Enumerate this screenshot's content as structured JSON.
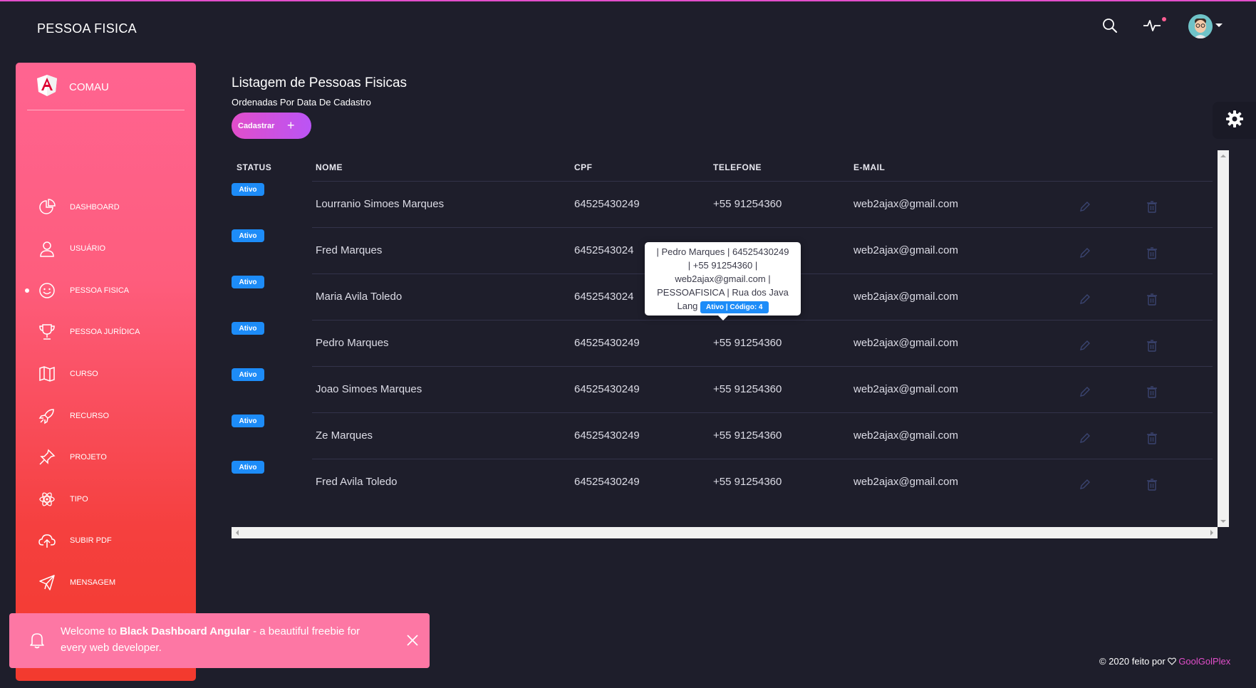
{
  "navbar": {
    "brand": "PESSOA FISICA"
  },
  "sidebar": {
    "title": "COMAU",
    "items": [
      {
        "label": "DASHBOARD",
        "icon": "chart-pie-icon",
        "active": false
      },
      {
        "label": "USUÁRIO",
        "icon": "user-icon",
        "active": false
      },
      {
        "label": "PESSOA FISICA",
        "icon": "smile-icon",
        "active": true
      },
      {
        "label": "PESSOA JURÍDICA",
        "icon": "trophy-icon",
        "active": false
      },
      {
        "label": "CURSO",
        "icon": "map-icon",
        "active": false
      },
      {
        "label": "RECURSO",
        "icon": "spaceship-icon",
        "active": false
      },
      {
        "label": "PROJETO",
        "icon": "pin-icon",
        "active": false
      },
      {
        "label": "TIPO",
        "icon": "atom-icon",
        "active": false
      },
      {
        "label": "SUBIR PDF",
        "icon": "cloud-upload-icon",
        "active": false
      },
      {
        "label": "MENSAGEM",
        "icon": "send-icon",
        "active": false
      }
    ]
  },
  "page": {
    "title": "Listagem de Pessoas Fisicas",
    "subtitle": "Ordenadas Por Data De Cadastro",
    "add_button": "Cadastrar",
    "add_icon": "+"
  },
  "table": {
    "headers": [
      "STATUS",
      "NOME",
      "CPF",
      "TELEFONE",
      "E-MAIL"
    ],
    "rows": [
      {
        "status": "Ativo",
        "nome": "Lourranio Simoes Marques",
        "cpf": "64525430249",
        "telefone": "+55 91254360",
        "email": "web2ajax@gmail.com"
      },
      {
        "status": "Ativo",
        "nome": "Fred Marques",
        "cpf": "6452543024",
        "telefone": "",
        "email": "web2ajax@gmail.com"
      },
      {
        "status": "Ativo",
        "nome": "Maria Avila Toledo",
        "cpf": "6452543024",
        "telefone": "",
        "email": "web2ajax@gmail.com"
      },
      {
        "status": "Ativo",
        "nome": "Pedro Marques",
        "cpf": "64525430249",
        "telefone": "+55 91254360",
        "email": "web2ajax@gmail.com"
      },
      {
        "status": "Ativo",
        "nome": "Joao Simoes Marques",
        "cpf": "64525430249",
        "telefone": "+55 91254360",
        "email": "web2ajax@gmail.com"
      },
      {
        "status": "Ativo",
        "nome": "Ze Marques",
        "cpf": "64525430249",
        "telefone": "+55 91254360",
        "email": "web2ajax@gmail.com"
      },
      {
        "status": "Ativo",
        "nome": "Fred Avila Toledo",
        "cpf": "64525430249",
        "telefone": "+55 91254360",
        "email": "web2ajax@gmail.com"
      }
    ]
  },
  "tooltip": {
    "line1": "| Pedro Marques | 64525430249",
    "line2": "| +55 91254360 |",
    "line3": "web2ajax@gmail.com |",
    "line4": "PESSOAFISICA | Rua dos Java",
    "line5": "Lang",
    "badge": "Ativo | Código: 4"
  },
  "notification": {
    "prefix": "Welcome to ",
    "bold": "Black Dashboard Angular",
    "suffix": " - a beautiful freebie for every web developer."
  },
  "footer": {
    "text": "© 2020 feito por ",
    "link": "GoolGolPlex"
  },
  "colors": {
    "accent": "#e14eca",
    "badge": "#1d8cf8",
    "background": "#1e1e2b",
    "sidebar_top": "#ff6491",
    "sidebar_bottom": "#f33a2e"
  }
}
